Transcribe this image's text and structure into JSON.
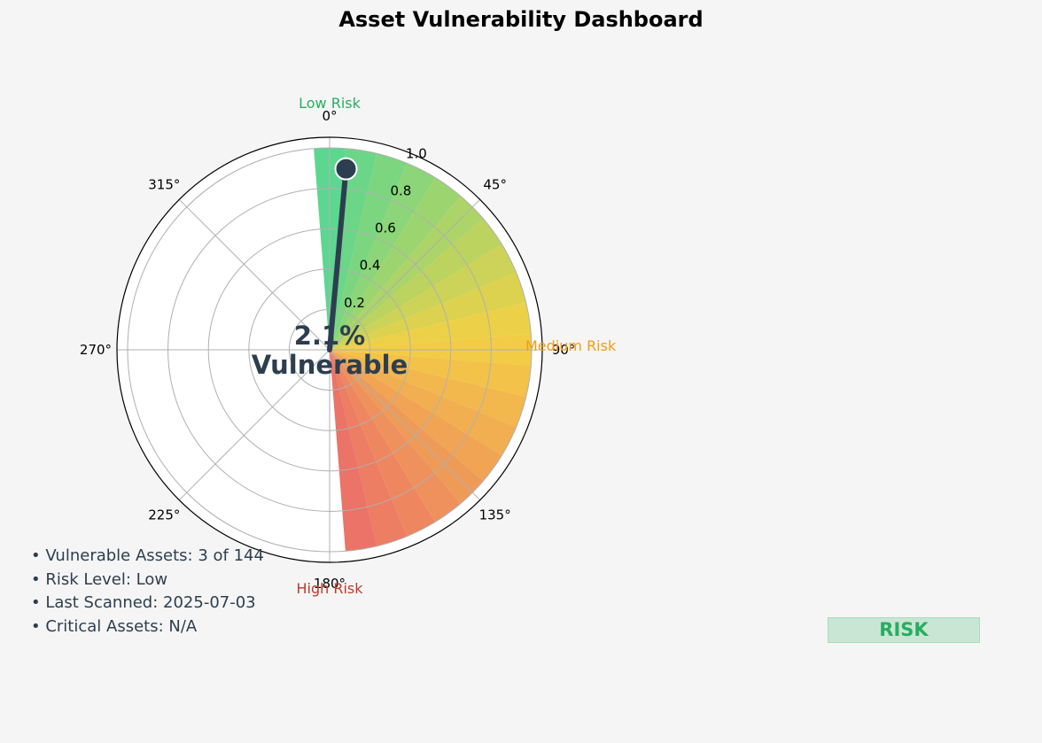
{
  "title": "Asset Vulnerability Dashboard",
  "chart_data": {
    "type": "gauge",
    "value_percent": 2.1,
    "value_label": "2.1%",
    "sub_label": "Vulnerable",
    "needle_fraction": 0.021,
    "needle_radius": 0.9,
    "radial_ticks": [
      "0.2",
      "0.4",
      "0.6",
      "0.8",
      "1.0"
    ],
    "angle_ticks": [
      "0°",
      "45°",
      "90°",
      "135°",
      "180°",
      "225°",
      "270°",
      "315°"
    ],
    "zone_labels": {
      "low": "Low Risk",
      "medium": "Medium Risk",
      "high": "High Risk"
    },
    "gauge_range_degrees": [
      0,
      180
    ],
    "segment_count": 20,
    "colors": {
      "low": "#2ecc71",
      "medium": "#f1c40f",
      "high": "#e74c3c",
      "needle": "#2c3e50",
      "low_label": "#27ae60",
      "medium_label": "#f39c12",
      "high_label": "#c0392b"
    }
  },
  "info": {
    "line1": "• Vulnerable Assets: 3 of 144",
    "line2": "• Risk Level: Low",
    "line3": "• Last Scanned: 2025-07-03",
    "line4": "• Critical Assets: N/A"
  },
  "badge": {
    "label": "RISK",
    "color": "#27ae60"
  }
}
